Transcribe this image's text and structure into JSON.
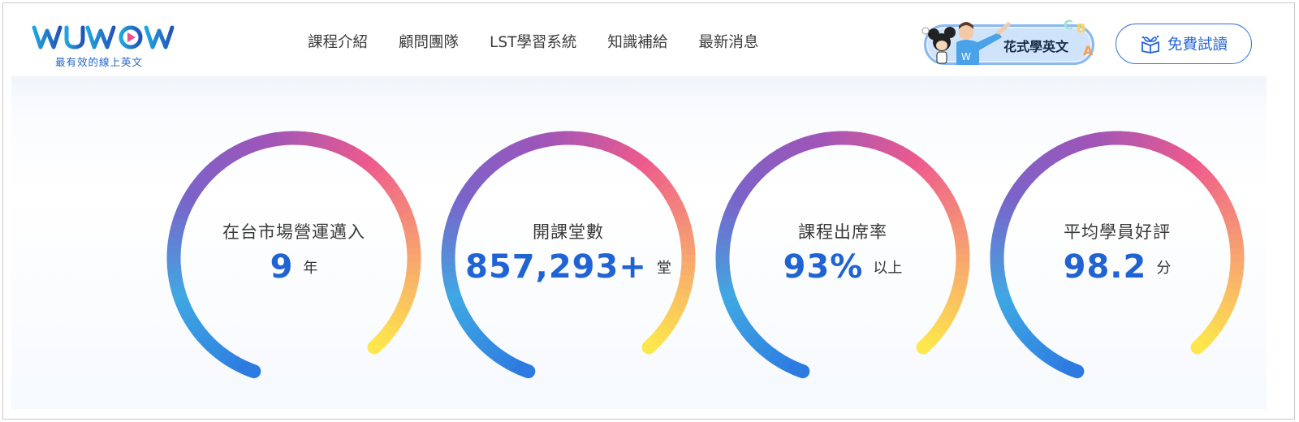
{
  "brand": {
    "logo_text": "WUWOW",
    "tagline": "最有效的線上英文",
    "colors": {
      "primary": "#2366c9",
      "accent": "#1fa6e0"
    }
  },
  "nav": {
    "items": [
      "課程介紹",
      "顧問團隊",
      "LST學習系統",
      "知識補給",
      "最新消息"
    ]
  },
  "promo": {
    "label": "花式學英文",
    "icon": "mascot-promo-icon"
  },
  "trial": {
    "label": "免費試讀",
    "icon": "gift-book-icon"
  },
  "stats": [
    {
      "label": "在台市場營運邁入",
      "value": "9",
      "unit": "年"
    },
    {
      "label": "開課堂數",
      "value": "857,293+",
      "unit": "堂"
    },
    {
      "label": "課程出席率",
      "value": "93%",
      "unit": "以上"
    },
    {
      "label": "平均學員好評",
      "value": "98.2",
      "unit": "分"
    }
  ],
  "ring_colors": [
    "#fde74c",
    "#f7a271",
    "#ee5a8c",
    "#a055b8",
    "#7b63c9",
    "#3fa8e3",
    "#2d7ae0"
  ]
}
